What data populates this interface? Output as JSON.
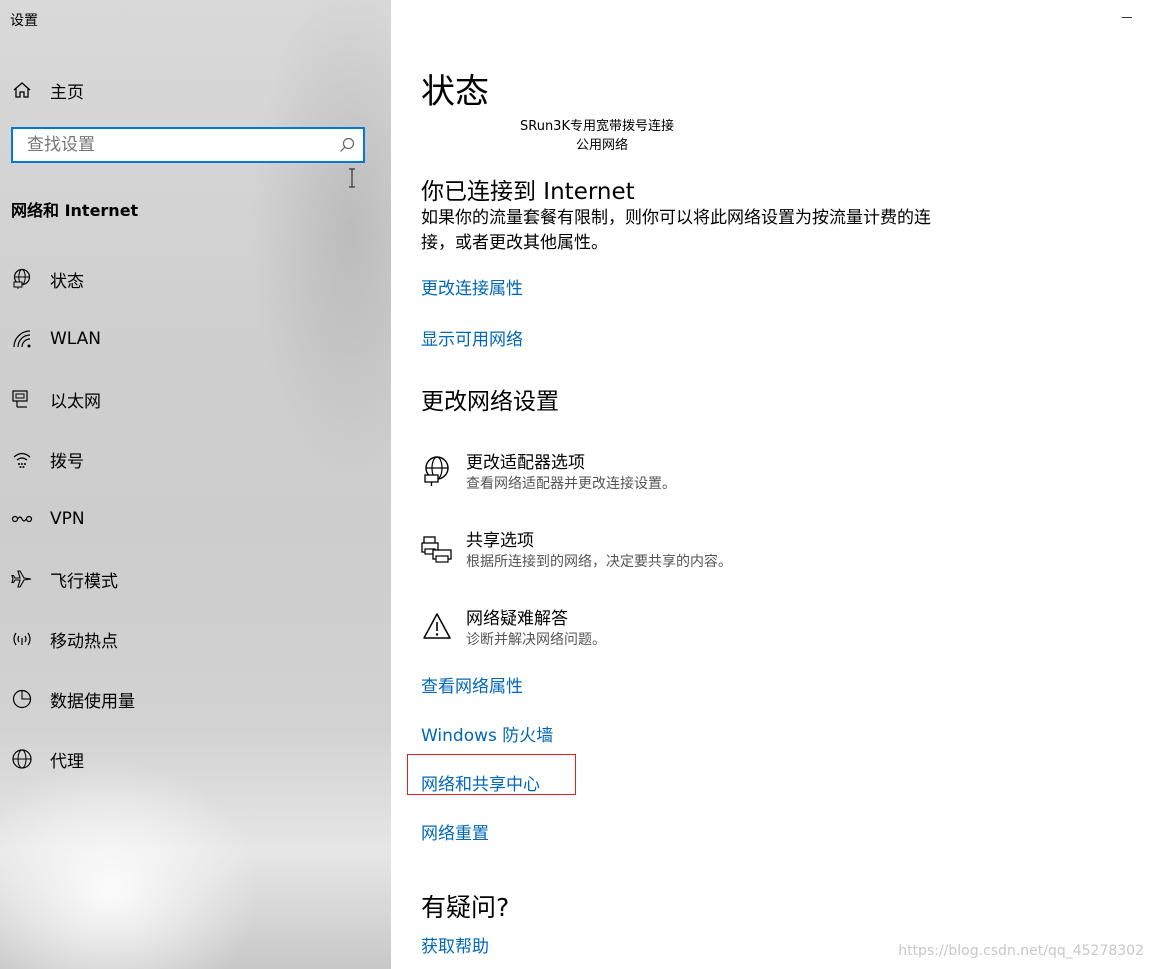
{
  "app": {
    "title": "设置"
  },
  "sidebar": {
    "home": {
      "label": "主页",
      "icon": "home-icon"
    },
    "search": {
      "placeholder": "查找设置",
      "value": ""
    },
    "section_title": "网络和 Internet",
    "items": [
      {
        "label": "状态",
        "icon": "globe-monitor-icon"
      },
      {
        "label": "WLAN",
        "icon": "wifi-icon"
      },
      {
        "label": "以太网",
        "icon": "ethernet-icon"
      },
      {
        "label": "拨号",
        "icon": "dialup-icon"
      },
      {
        "label": "VPN",
        "icon": "vpn-icon"
      },
      {
        "label": "飞行模式",
        "icon": "airplane-icon"
      },
      {
        "label": "移动热点",
        "icon": "hotspot-icon"
      },
      {
        "label": "数据使用量",
        "icon": "data-usage-icon"
      },
      {
        "label": "代理",
        "icon": "globe-icon"
      }
    ]
  },
  "main": {
    "title": "状态",
    "connection": {
      "name": "SRun3K专用宽带拨号连接",
      "type": "公用网络"
    },
    "connected_heading": "你已连接到 Internet",
    "connected_desc": "如果你的流量套餐有限制，则你可以将此网络设置为按流量计费的连接，或者更改其他属性。",
    "links_top": {
      "change_props": "更改连接属性",
      "show_networks": "显示可用网络"
    },
    "change_heading": "更改网络设置",
    "options": [
      {
        "title": "更改适配器选项",
        "desc": "查看网络适配器并更改连接设置。",
        "icon": "adapter-globe-icon"
      },
      {
        "title": "共享选项",
        "desc": "根据所连接到的网络，决定要共享的内容。",
        "icon": "sharing-printer-icon"
      },
      {
        "title": "网络疑难解答",
        "desc": "诊断并解决网络问题。",
        "icon": "warning-triangle-icon"
      }
    ],
    "links_bottom": {
      "view_props": "查看网络属性",
      "firewall": "Windows 防火墙",
      "sharing_center": "网络和共享中心",
      "reset": "网络重置"
    },
    "question_heading": "有疑问?",
    "help_link": "获取帮助"
  },
  "colors": {
    "accent": "#0078d7",
    "link": "#0067b8",
    "highlight": "#e02020"
  },
  "watermark": "https://blog.csdn.net/qq_45278302"
}
